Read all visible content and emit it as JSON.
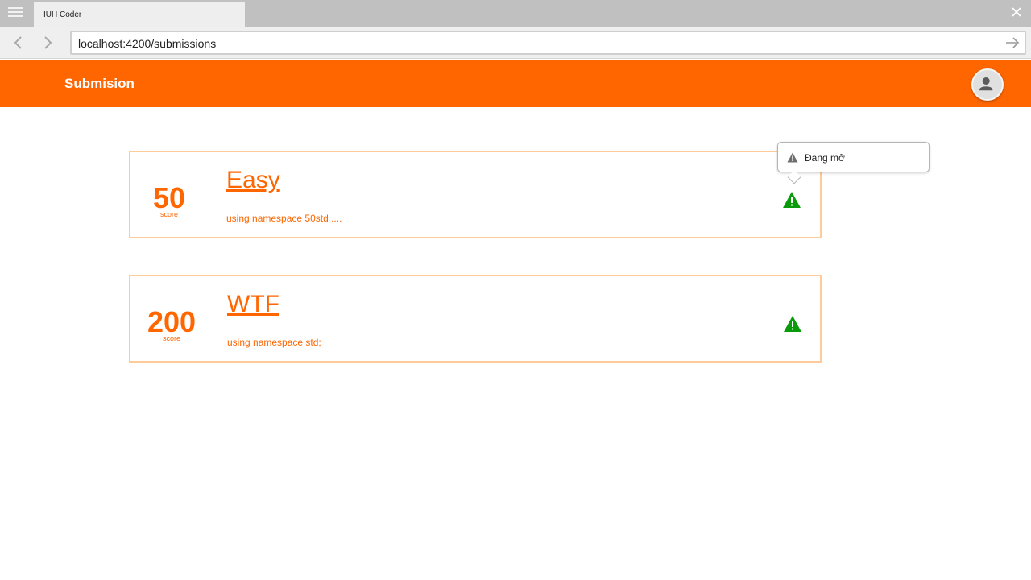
{
  "browser": {
    "tab_title": "IUH Coder",
    "url": "localhost:4200/submissions"
  },
  "header": {
    "title": "Submision",
    "brand_color": "#ff6600"
  },
  "submissions": [
    {
      "score": "50",
      "score_label": "score",
      "title": "Easy",
      "code": "using namespace 50std ....",
      "status_icon": "warning-icon"
    },
    {
      "score": "200",
      "score_label": "score",
      "title": "WTF",
      "code": "using namespace std;",
      "status_icon": "warning-icon"
    }
  ],
  "tooltip": {
    "text": "Đang mở",
    "icon": "warning-icon"
  },
  "colors": {
    "accent": "#ff6600",
    "card_border": "#ffcc99",
    "warning_green": "#0a9b0a"
  }
}
